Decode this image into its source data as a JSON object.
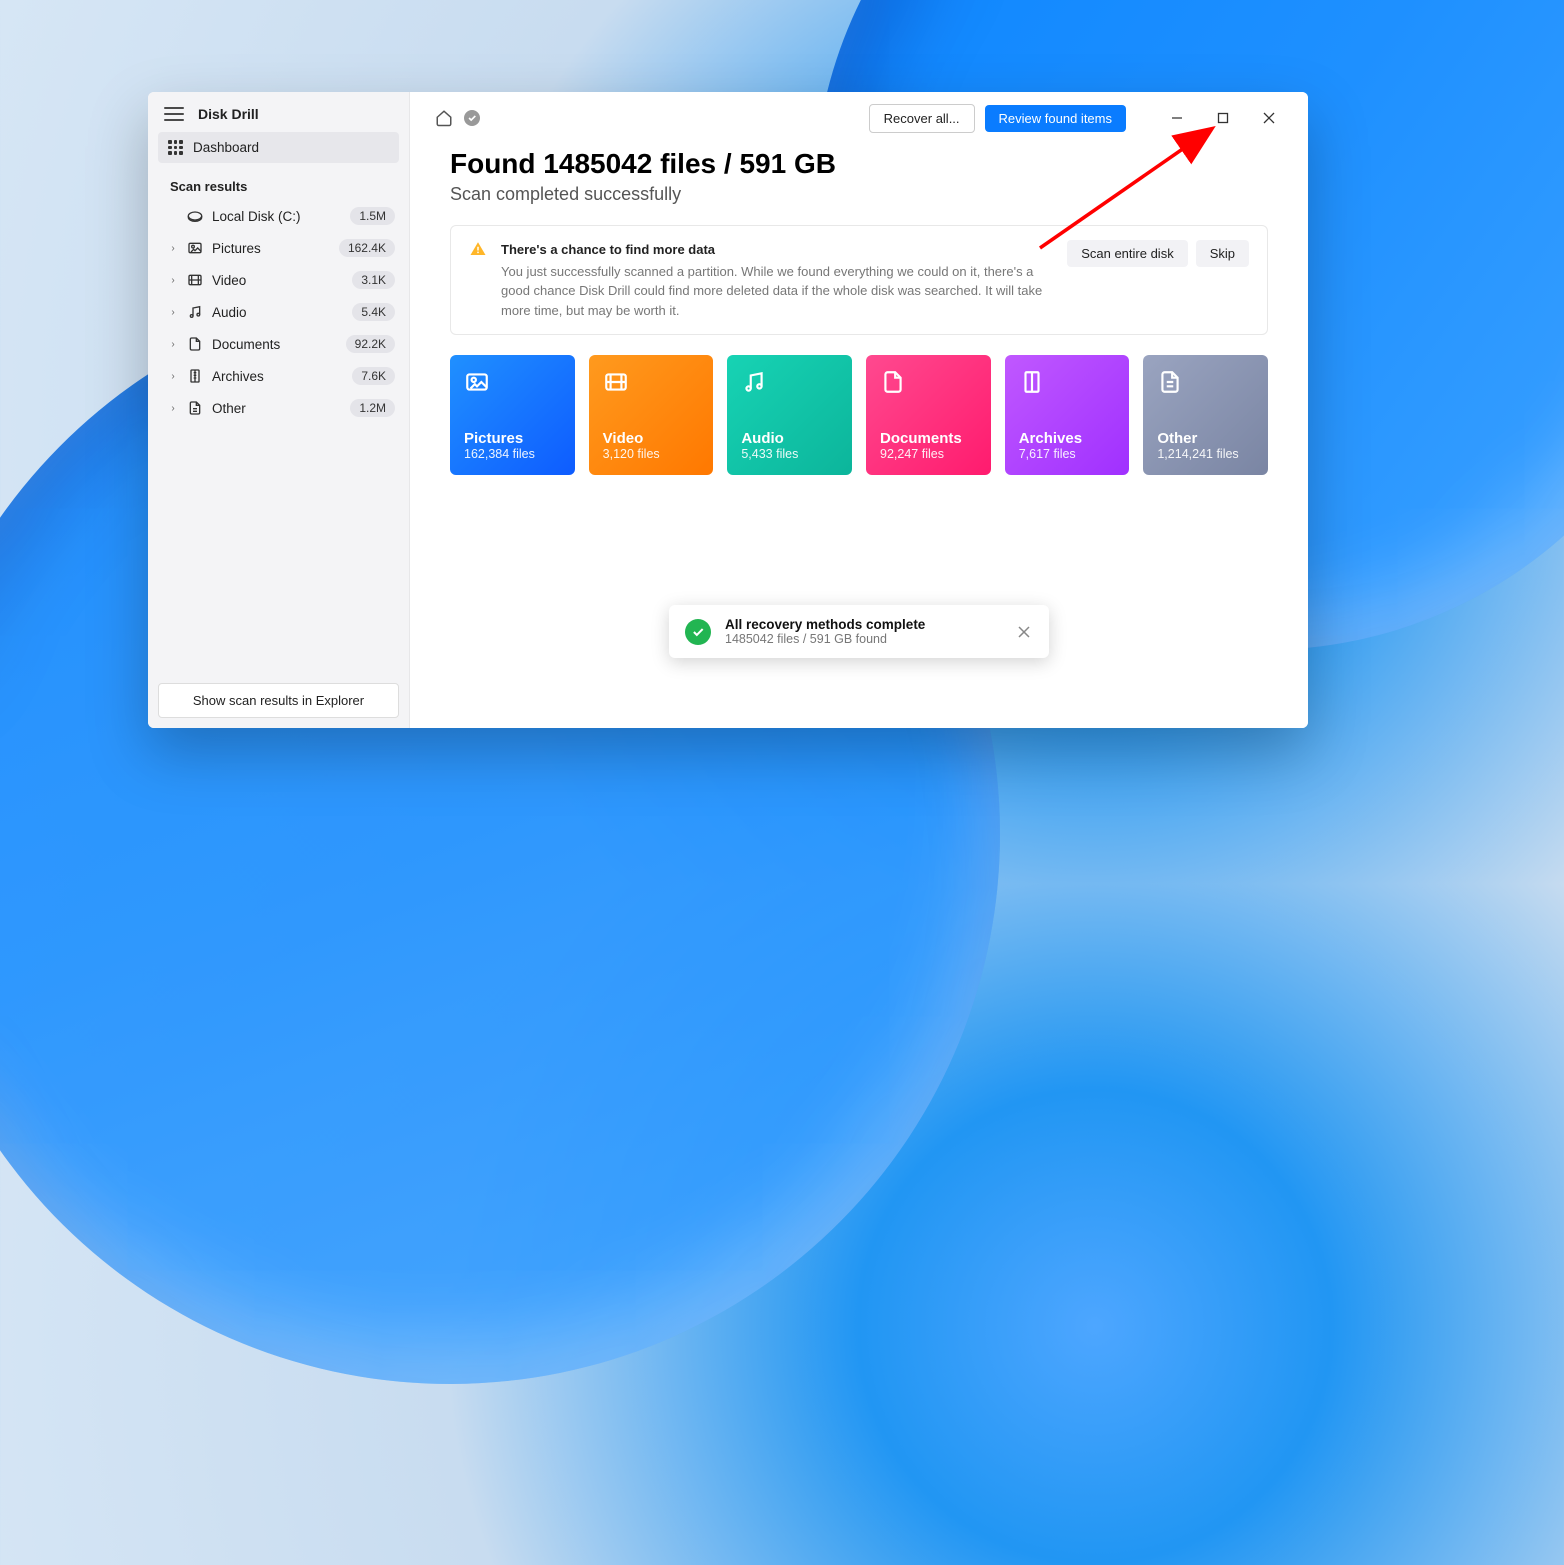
{
  "app": {
    "title": "Disk Drill"
  },
  "sidebar": {
    "dashboard": "Dashboard",
    "scan_results_label": "Scan results",
    "items": [
      {
        "icon": "disk",
        "label": "Local Disk (C:)",
        "badge": "1.5M",
        "expandable": false
      },
      {
        "icon": "pictures",
        "label": "Pictures",
        "badge": "162.4K",
        "expandable": true
      },
      {
        "icon": "video",
        "label": "Video",
        "badge": "3.1K",
        "expandable": true
      },
      {
        "icon": "audio",
        "label": "Audio",
        "badge": "5.4K",
        "expandable": true
      },
      {
        "icon": "documents",
        "label": "Documents",
        "badge": "92.2K",
        "expandable": true
      },
      {
        "icon": "archives",
        "label": "Archives",
        "badge": "7.6K",
        "expandable": true
      },
      {
        "icon": "other",
        "label": "Other",
        "badge": "1.2M",
        "expandable": true
      }
    ],
    "footer_button": "Show scan results in Explorer"
  },
  "toolbar": {
    "recover_all": "Recover all...",
    "review_found": "Review found items"
  },
  "results": {
    "heading": "Found 1485042 files / 591 GB",
    "subheading": "Scan completed successfully"
  },
  "info": {
    "title": "There's a chance to find more data",
    "body": "You just successfully scanned a partition. While we found everything we could on it, there's a good chance Disk Drill could find more deleted data if the whole disk was searched. It will take more time, but may be worth it.",
    "scan_entire": "Scan entire disk",
    "skip": "Skip"
  },
  "cards": [
    {
      "kind": "pictures",
      "title": "Pictures",
      "count": "162,384 files"
    },
    {
      "kind": "video",
      "title": "Video",
      "count": "3,120 files"
    },
    {
      "kind": "audio",
      "title": "Audio",
      "count": "5,433 files"
    },
    {
      "kind": "documents",
      "title": "Documents",
      "count": "92,247 files"
    },
    {
      "kind": "archives",
      "title": "Archives",
      "count": "7,617 files"
    },
    {
      "kind": "other",
      "title": "Other",
      "count": "1,214,241 files"
    }
  ],
  "toast": {
    "title": "All recovery methods complete",
    "subtitle": "1485042 files / 591 GB found"
  }
}
